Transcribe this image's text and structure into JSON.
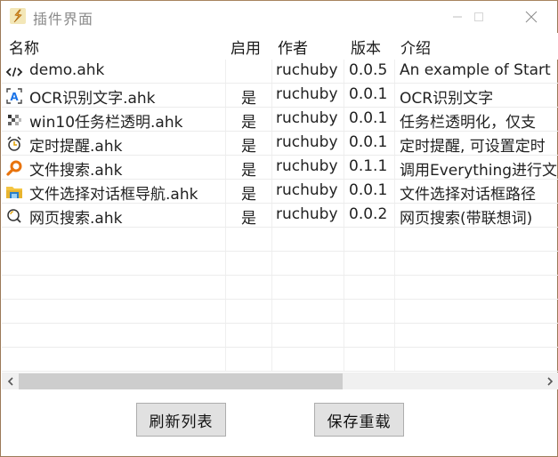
{
  "window": {
    "title": "插件界面",
    "controls": {
      "minimize": "minimize",
      "maximize": "maximize",
      "close": "close"
    }
  },
  "list": {
    "columns": [
      "名称",
      "启用",
      "作者",
      "版本",
      "介绍"
    ],
    "rows": [
      {
        "icon": "code-icon",
        "name": "demo.ahk",
        "enabled": "",
        "author": "ruchuby",
        "version": "0.0.5",
        "description": "An example of Start"
      },
      {
        "icon": "ocr-text-icon",
        "name": "OCR识别文字.ahk",
        "enabled": "是",
        "author": "ruchuby",
        "version": "0.0.1",
        "description": "OCR识别文字"
      },
      {
        "icon": "transparency-checker-icon",
        "name": "win10任务栏透明.ahk",
        "enabled": "是",
        "author": "ruchuby",
        "version": "0.0.1",
        "description": "任务栏透明化，仅支"
      },
      {
        "icon": "alarm-clock-icon",
        "name": "定时提醒.ahk",
        "enabled": "是",
        "author": "ruchuby",
        "version": "0.0.1",
        "description": "定时提醒, 可设置定时"
      },
      {
        "icon": "orange-search-icon",
        "name": "文件搜索.ahk",
        "enabled": "是",
        "author": "ruchuby",
        "version": "0.1.1",
        "description": "调用Everything进行文"
      },
      {
        "icon": "folder-icon",
        "name": "文件选择对话框导航.ahk",
        "enabled": "是",
        "author": "ruchuby",
        "version": "0.0.1",
        "description": "文件选择对话框路径"
      },
      {
        "icon": "web-search-icon",
        "name": "网页搜索.ahk",
        "enabled": "是",
        "author": "ruchuby",
        "version": "0.0.2",
        "description": "网页搜索(带联想词)"
      }
    ]
  },
  "scrollbar": {
    "left_arrow": "‹",
    "right_arrow": "›",
    "thumb_fraction": 0.62
  },
  "buttons": {
    "refresh": "刷新列表",
    "save_reload": "保存重载"
  }
}
